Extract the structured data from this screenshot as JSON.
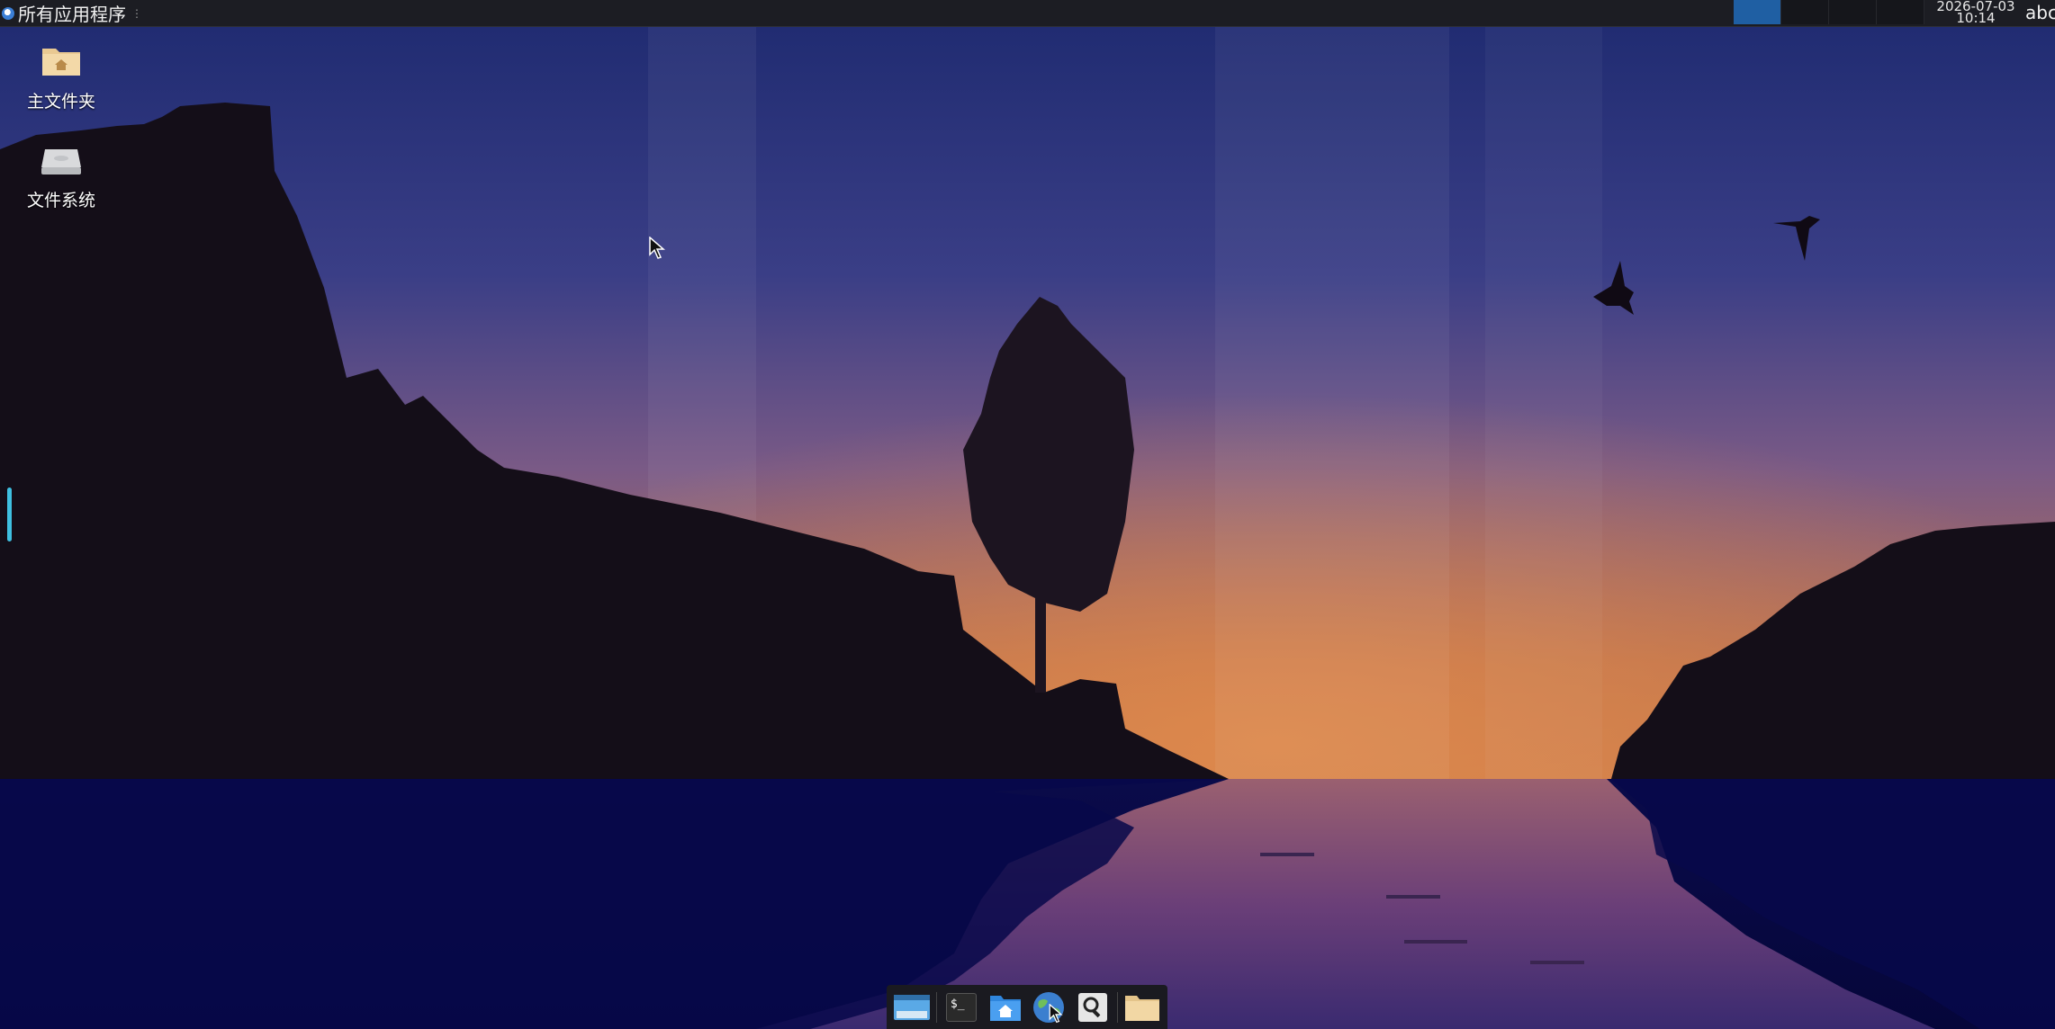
{
  "top_panel": {
    "app_menu_label": "所有应用程序",
    "clock_date": "2026-07-03",
    "clock_time": "10:14",
    "keyboard_layout": "abc",
    "workspace_count": 4,
    "active_workspace": 1
  },
  "desktop_icons": [
    {
      "label": "主文件夹",
      "icon": "home-folder-icon"
    },
    {
      "label": "文件系统",
      "icon": "filesystem-drive-icon"
    }
  ],
  "dock": {
    "items": [
      {
        "name": "show-desktop",
        "icon": "show-desktop-icon"
      },
      {
        "name": "terminal",
        "icon": "terminal-icon",
        "glyph": "$_"
      },
      {
        "name": "home-folder",
        "icon": "home-folder-icon"
      },
      {
        "name": "web-browser",
        "icon": "globe-icon"
      },
      {
        "name": "app-finder",
        "icon": "search-icon"
      },
      {
        "name": "file-manager",
        "icon": "folder-icon"
      }
    ]
  },
  "colors": {
    "panel_bg": "#1c1d23",
    "active_workspace": "#1f5fa3",
    "edge_indicator": "#3fbfe0"
  }
}
